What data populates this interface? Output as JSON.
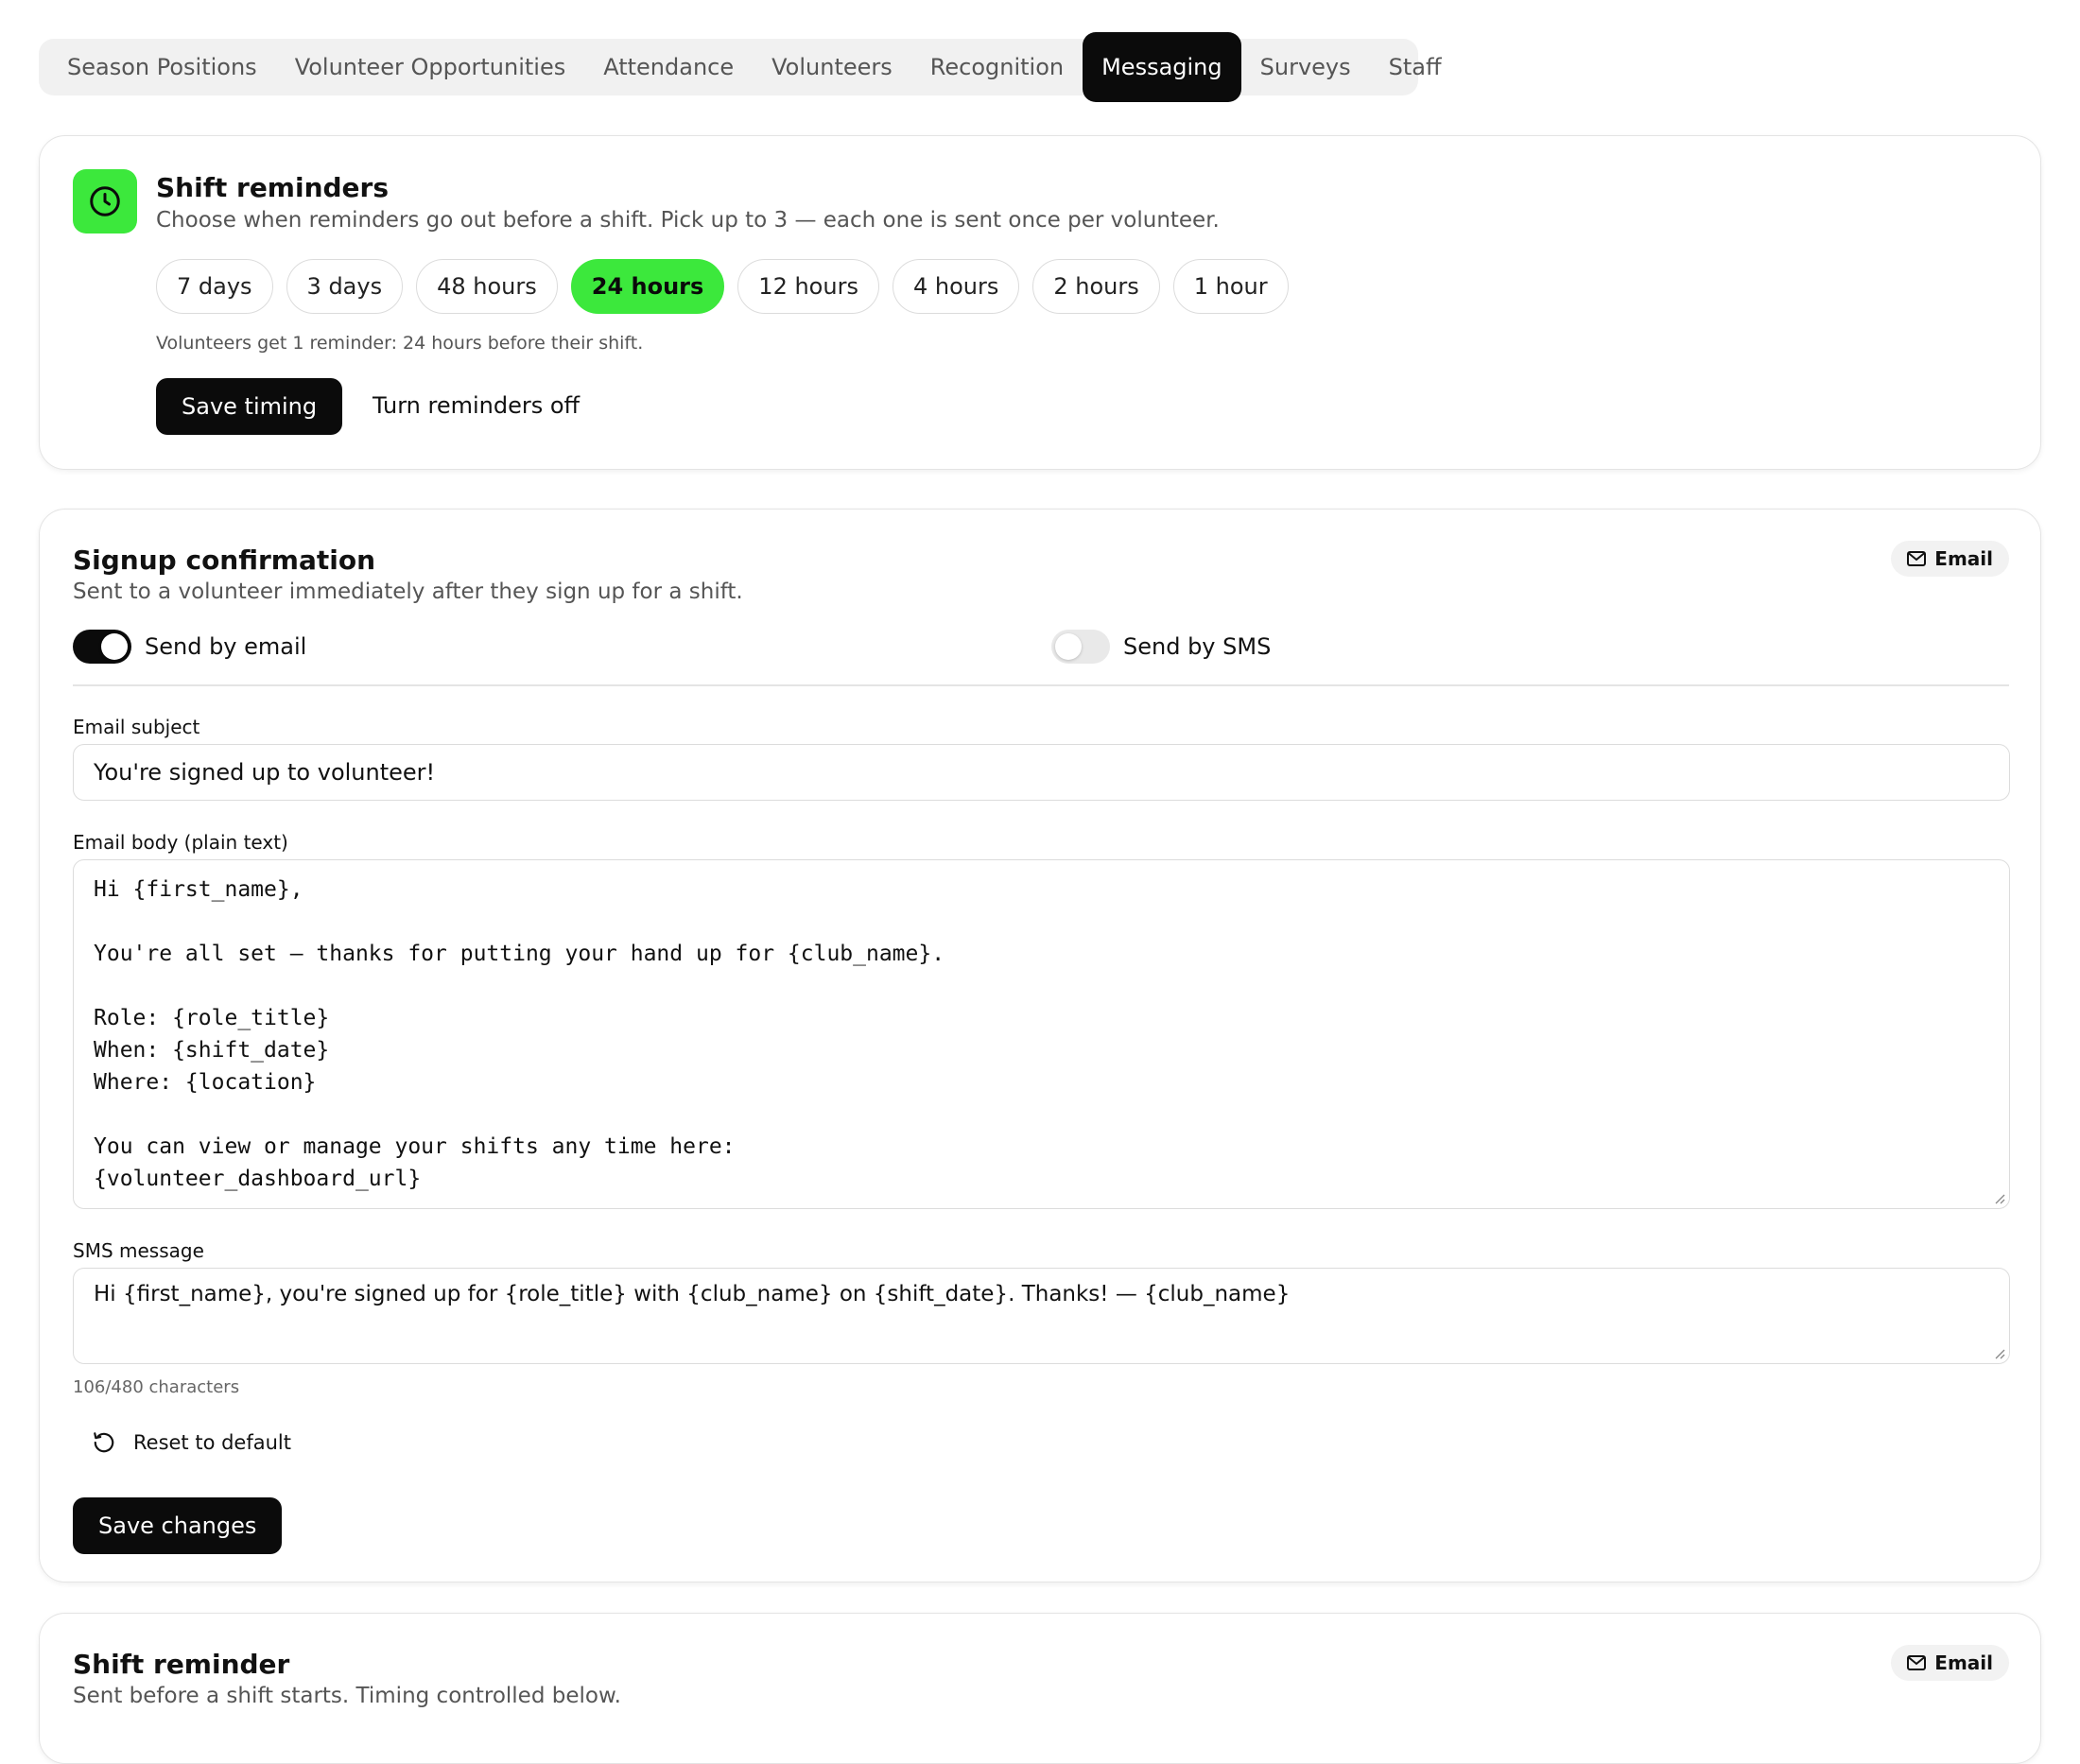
{
  "tabs": [
    {
      "label": "Season Positions"
    },
    {
      "label": "Volunteer Opportunities"
    },
    {
      "label": "Attendance"
    },
    {
      "label": "Volunteers"
    },
    {
      "label": "Recognition"
    },
    {
      "label": "Messaging",
      "active": true
    },
    {
      "label": "Surveys"
    },
    {
      "label": "Staff"
    }
  ],
  "shift_reminders": {
    "icon": "clock-icon",
    "title": "Shift reminders",
    "description": "Choose when reminders go out before a shift. Pick up to 3 — each one is sent once per volunteer.",
    "options": [
      {
        "label": "7 days"
      },
      {
        "label": "3 days"
      },
      {
        "label": "48 hours"
      },
      {
        "label": "24 hours",
        "selected": true
      },
      {
        "label": "12 hours"
      },
      {
        "label": "4 hours"
      },
      {
        "label": "2 hours"
      },
      {
        "label": "1 hour"
      }
    ],
    "note": "Volunteers get 1 reminder: 24 hours before their shift.",
    "save_label": "Save timing",
    "off_label": "Turn reminders off"
  },
  "signup_confirmation": {
    "title": "Signup confirmation",
    "description": "Sent to a volunteer immediately after they sign up for a shift.",
    "badge": "Email",
    "badge_icon": "mail-icon",
    "send_email": {
      "label": "Send by email",
      "on": true
    },
    "send_sms": {
      "label": "Send by SMS",
      "on": false
    },
    "subject_label": "Email subject",
    "subject_value": "You're signed up to volunteer!",
    "body_label": "Email body (plain text)",
    "body_value": "Hi {first_name},\n\nYou're all set — thanks for putting your hand up for {club_name}.\n\nRole: {role_title}\nWhen: {shift_date}\nWhere: {location}\n\nYou can view or manage your shifts any time here:\n{volunteer_dashboard_url}",
    "sms_label": "SMS message",
    "sms_value": "Hi {first_name}, you're signed up for {role_title} with {club_name} on {shift_date}. Thanks! — {club_name}",
    "char_count": "106/480 characters",
    "reset_label": "Reset to default",
    "reset_icon": "reset-icon",
    "save_label": "Save changes"
  },
  "shift_reminder": {
    "title": "Shift reminder",
    "description": "Sent before a shift starts. Timing controlled below.",
    "badge": "Email",
    "badge_icon": "mail-icon"
  },
  "colors": {
    "accent": "#3ce83c",
    "dark": "#0b0b0b"
  }
}
